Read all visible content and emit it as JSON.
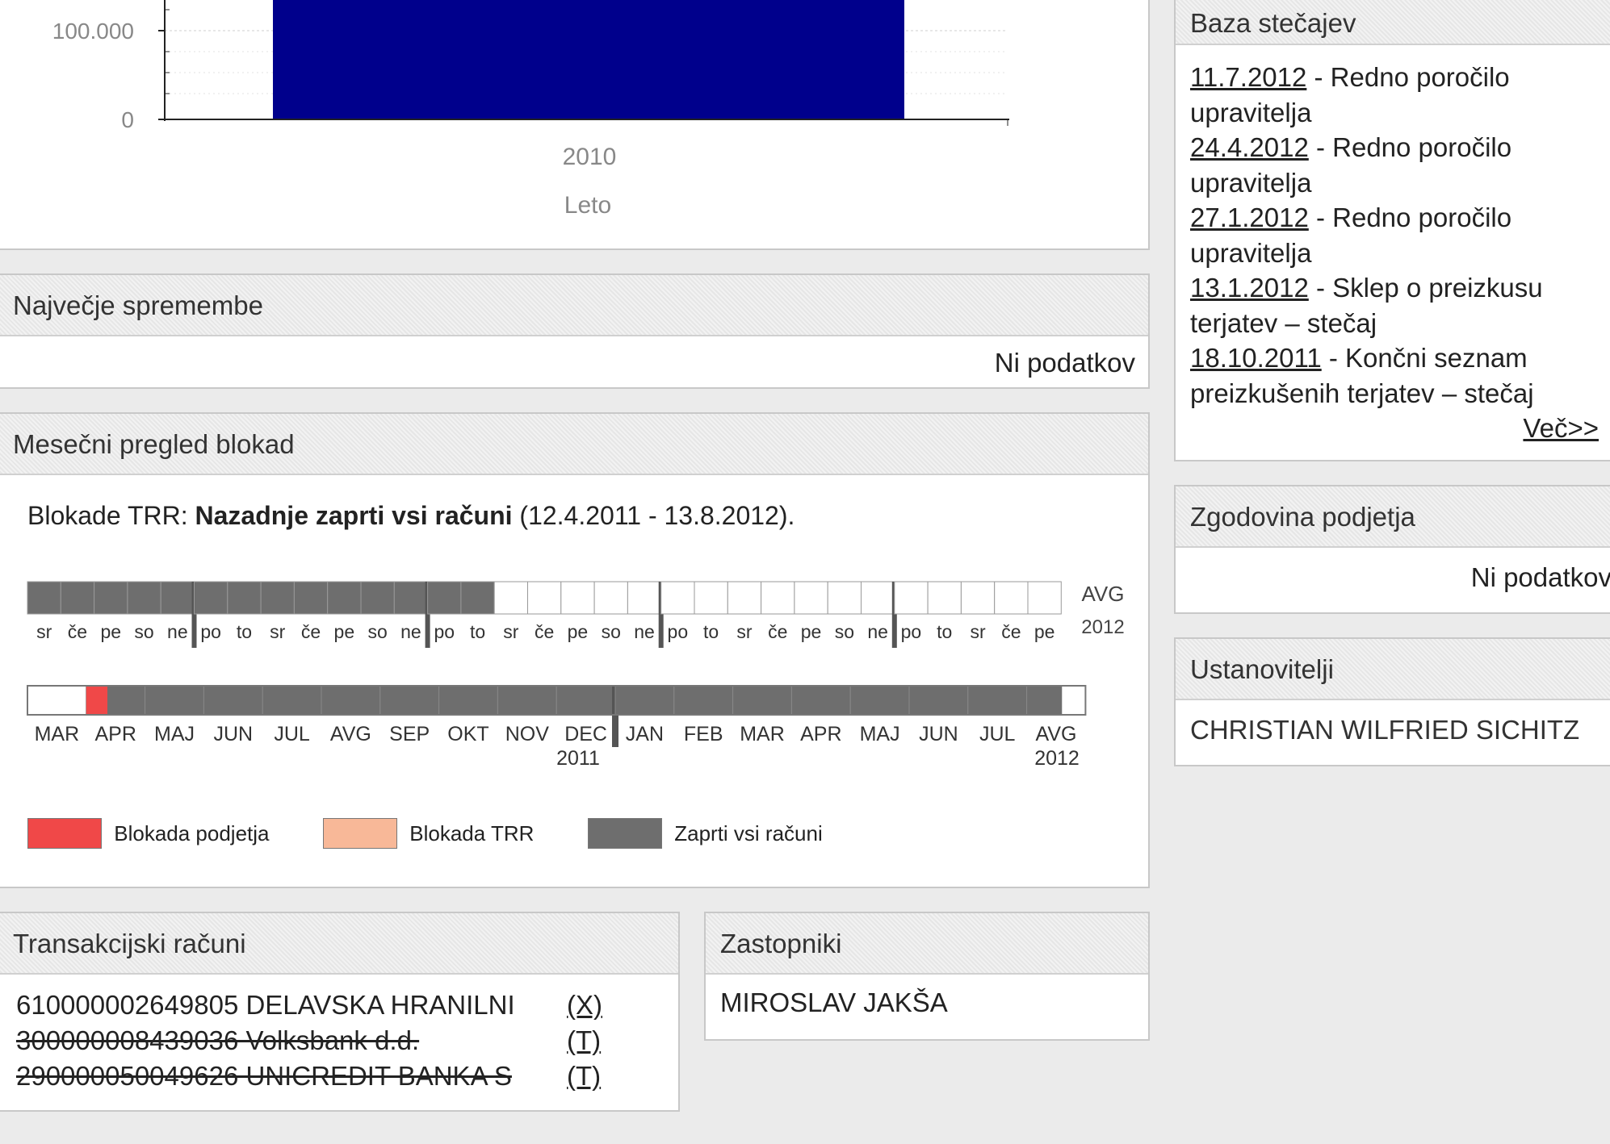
{
  "top_chart": {
    "y_ticks": [
      "100.000",
      "0"
    ],
    "x_tick": "2010",
    "x_label": "Leto",
    "bar_color": "#00008c"
  },
  "bankruptcy": {
    "title": "Baza stečajev",
    "items": [
      {
        "date": "11.7.2012",
        "text": " - Redno poročilo upravitelja"
      },
      {
        "date": "24.4.2012",
        "text": " - Redno poročilo upravitelja"
      },
      {
        "date": "27.1.2012",
        "text": " - Redno poročilo upravitelja"
      },
      {
        "date": "13.1.2012",
        "text": " - Sklep o preizkusu terjatev – stečaj"
      },
      {
        "date": "18.10.2011",
        "text": " - Končni seznam preizkušenih terjatev – stečaj"
      }
    ],
    "more": "Več>>"
  },
  "biggest_changes": {
    "title": "Največje spremembe",
    "no_data": "Ni podatkov"
  },
  "history": {
    "title": "Zgodovina podjetja",
    "no_data": "Ni podatkov"
  },
  "founders": {
    "title": "Ustanovitelji",
    "name": "CHRISTIAN WILFRIED SICHITZ"
  },
  "blockades": {
    "title": "Mesečni pregled blokad",
    "summary_prefix": "Blokade TRR: ",
    "summary_bold": "Nazadnje zaprti vsi računi",
    "summary_suffix": " (12.4.2011 - 13.8.2012).",
    "daily_days": [
      "sr",
      "če",
      "pe",
      "so",
      "ne",
      "po",
      "to",
      "sr",
      "če",
      "pe",
      "so",
      "ne",
      "po",
      "to",
      "sr",
      "če",
      "pe",
      "so",
      "ne",
      "po",
      "to",
      "sr",
      "če",
      "pe",
      "so",
      "ne",
      "po",
      "to",
      "sr",
      "če",
      "pe"
    ],
    "daily_state": [
      "c",
      "c",
      "c",
      "c",
      "c",
      "c",
      "c",
      "c",
      "c",
      "c",
      "c",
      "c",
      "c",
      "c",
      "n",
      "n",
      "n",
      "n",
      "n",
      "n",
      "n",
      "n",
      "n",
      "n",
      "n",
      "n",
      "n",
      "n",
      "n",
      "n",
      "n"
    ],
    "daily_month": "AVG",
    "daily_year": "2012",
    "monthly_months": [
      "MAR",
      "APR",
      "MAJ",
      "JUN",
      "JUL",
      "AVG",
      "SEP",
      "OKT",
      "NOV",
      "DEC",
      "JAN",
      "FEB",
      "MAR",
      "APR",
      "MAJ",
      "JUN",
      "JUL",
      "AVG"
    ],
    "monthly_year_1": "2011",
    "monthly_year_2": "2012",
    "legend": [
      {
        "label": "Blokada podjetja",
        "color": "#f04848"
      },
      {
        "label": "Blokada TRR",
        "color": "#f8b898"
      },
      {
        "label": "Zaprti vsi računi",
        "color": "#6e6e6e"
      }
    ]
  },
  "accounts": {
    "title": "Transakcijski računi",
    "rows": [
      {
        "text": "610000002649805 DELAVSKA HRANILNI",
        "tag": "(X)",
        "closed": false
      },
      {
        "text": "300000008439036 Volksbank d.d.",
        "tag": "(T)",
        "closed": true
      },
      {
        "text": "290000050049626 UNICREDIT BANKA S",
        "tag": "(T)",
        "closed": true
      }
    ]
  },
  "representatives": {
    "title": "Zastopniki",
    "name": "MIROSLAV JAKŠA"
  }
}
